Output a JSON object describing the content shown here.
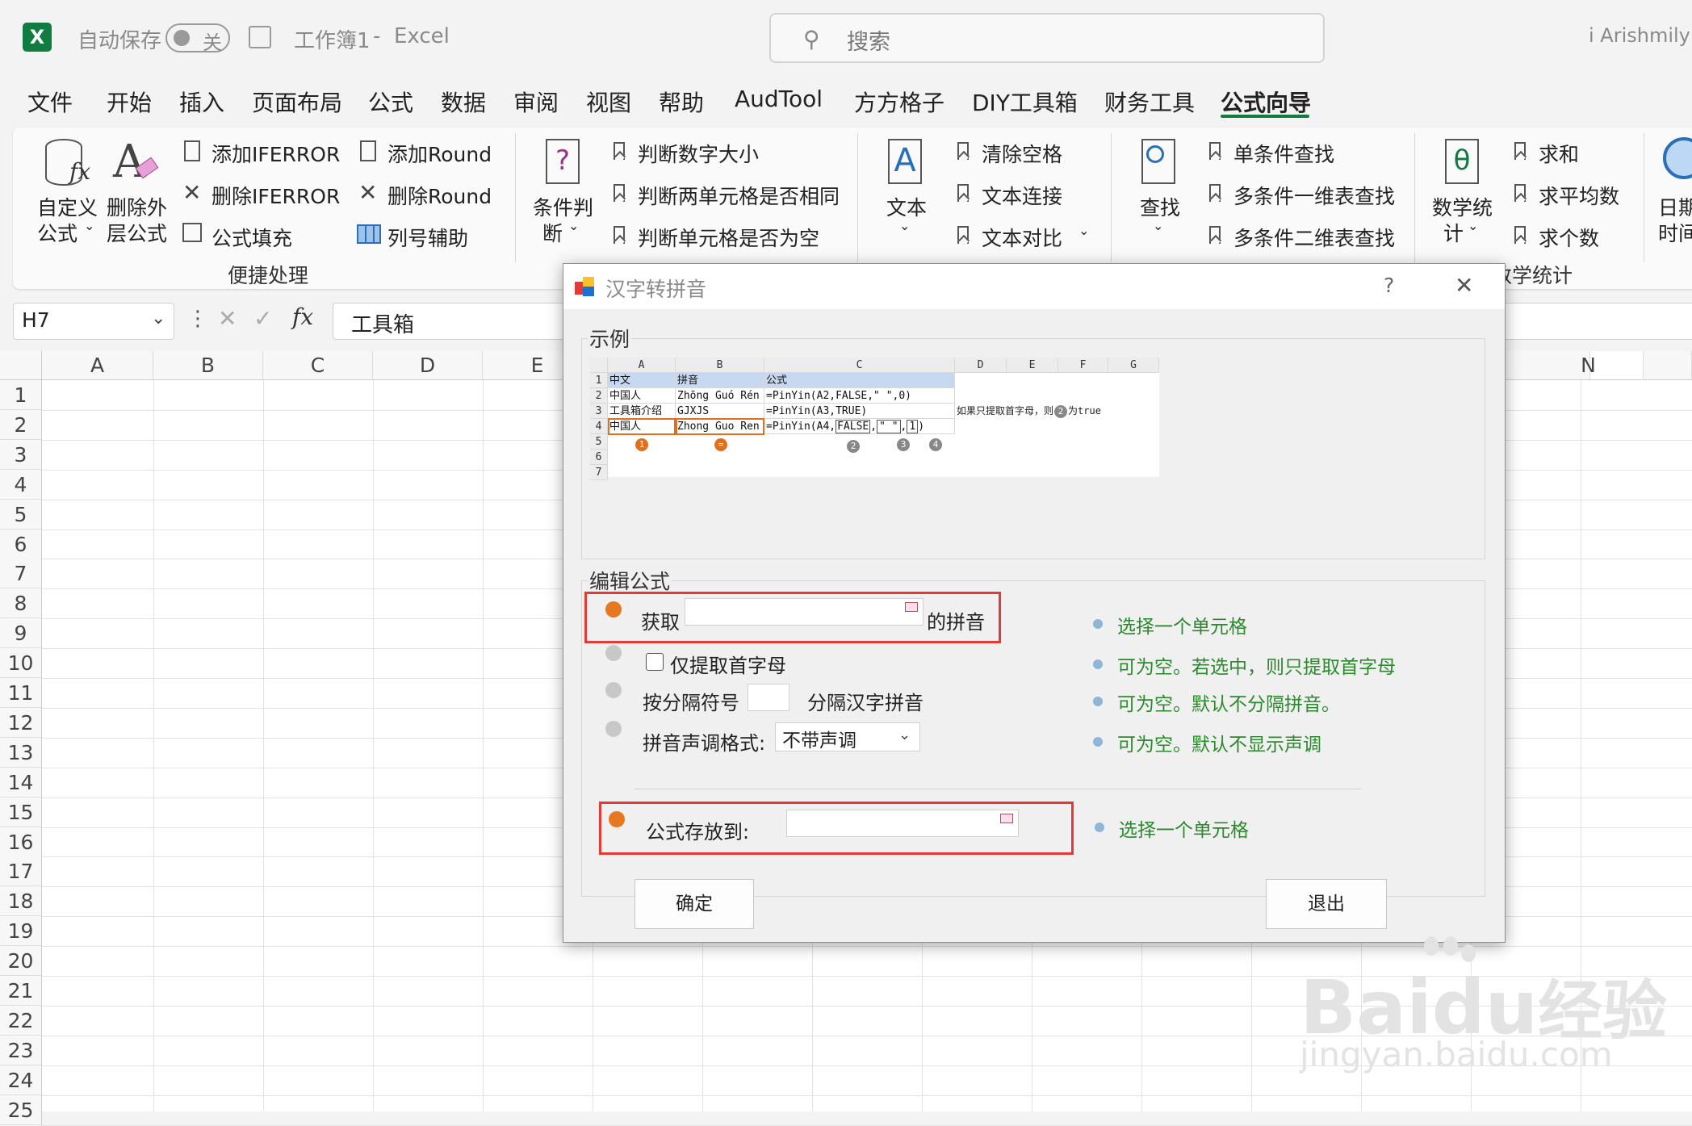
{
  "titlebar": {
    "autosave_label": "自动保存",
    "autosave_state": "关",
    "doc_name": "工作簿1",
    "dash": "-",
    "app_name": "Excel",
    "search_placeholder": "搜索",
    "user": "i Arishmily"
  },
  "tabs": [
    "文件",
    "开始",
    "插入",
    "页面布局",
    "公式",
    "数据",
    "审阅",
    "视图",
    "帮助",
    "AudTool",
    "方方格子",
    "DIY工具箱",
    "财务工具",
    "公式向导"
  ],
  "ribbon": {
    "custom_formula": [
      "自定义",
      "公式"
    ],
    "remove_outer": [
      "删除外",
      "层公式"
    ],
    "add_iferror": "添加IFERROR",
    "del_iferror": "删除IFERROR",
    "formula_fill": "公式填充",
    "add_round": "添加Round",
    "del_round": "删除Round",
    "col_helper": "列号辅助",
    "group_quick": "便捷处理",
    "cond_judge": [
      "条件判",
      "断"
    ],
    "judge_num_size": "判断数字大小",
    "judge_two_same": "判断两单元格是否相同",
    "judge_empty": "判断单元格是否为空",
    "text": "文本",
    "clear_space": "清除空格",
    "text_concat": "文本连接",
    "text_compare": "文本对比",
    "lookup": "查找",
    "single_lookup": "单条件查找",
    "multi_1d": "多条件一维表查找",
    "multi_2d": "多条件二维表查找",
    "math_stats": [
      "数学统",
      "计"
    ],
    "sum": "求和",
    "average": "求平均数",
    "count": "求个数",
    "group_math": "数学统计",
    "date_time": [
      "日期",
      "时间"
    ]
  },
  "formula_bar": {
    "cell_ref": "H7",
    "content": "工具箱",
    "fx": "fx"
  },
  "columns": [
    "A",
    "B",
    "C",
    "D",
    "E",
    "N"
  ],
  "rows": [
    "1",
    "2",
    "3",
    "4",
    "5",
    "6",
    "7",
    "8",
    "9",
    "10",
    "11",
    "12",
    "13",
    "14",
    "15",
    "16",
    "17",
    "18",
    "19",
    "20",
    "21",
    "22",
    "23",
    "24",
    "25"
  ],
  "dialog": {
    "title": "汉字转拼音",
    "help": "?",
    "close": "✕",
    "example_label": "示例",
    "edit_label": "编辑公式",
    "get_label": "获取",
    "pinyin_suffix": "的拼音",
    "first_letter_only": "仅提取首字母",
    "sep_prefix": "按分隔符号",
    "sep_suffix": "分隔汉字拼音",
    "tone_label": "拼音声调格式:",
    "tone_value": "不带声调",
    "store_label": "公式存放到:",
    "hint1": "选择一个单元格",
    "hint2": "可为空。若选中，则只提取首字母",
    "hint3": "可为空。默认不分隔拼音。",
    "hint4": "可为空。默认不显示声调",
    "hint5": "选择一个单元格",
    "ok": "确定",
    "exit": "退出"
  },
  "example": {
    "cols": [
      "A",
      "B",
      "C",
      "D",
      "E",
      "F",
      "G"
    ],
    "rows": [
      "1",
      "2",
      "3",
      "4",
      "5",
      "6",
      "7"
    ],
    "r1": [
      "中文",
      "拼音",
      "公式"
    ],
    "r2": [
      "中国人",
      "Zhōng Guó Rén",
      "=PinYin(A2,FALSE,\" \",0)"
    ],
    "r3": [
      "工具箱介绍",
      "GJXJS",
      "=PinYin(A3,TRUE)"
    ],
    "r3_note": "如果只提取首字母，则",
    "r3_note_num": "2",
    "r3_note_tail": "为true",
    "r4": [
      "中国人",
      "Zhong Guo Ren",
      "=PinYin(A4,"
    ],
    "r4_false": "FALSE",
    "r4_quote": "\" \"",
    "r4_one": "1",
    "r4_comma1": ",",
    "r4_comma2": ",",
    "r4_close": ")",
    "marks": [
      "1",
      "=",
      "2",
      "3",
      "4"
    ]
  },
  "watermark": {
    "brand": "Bai",
    "brand2": "du",
    "jingyan": "经验",
    "url": "jingyan.baidu.com"
  }
}
